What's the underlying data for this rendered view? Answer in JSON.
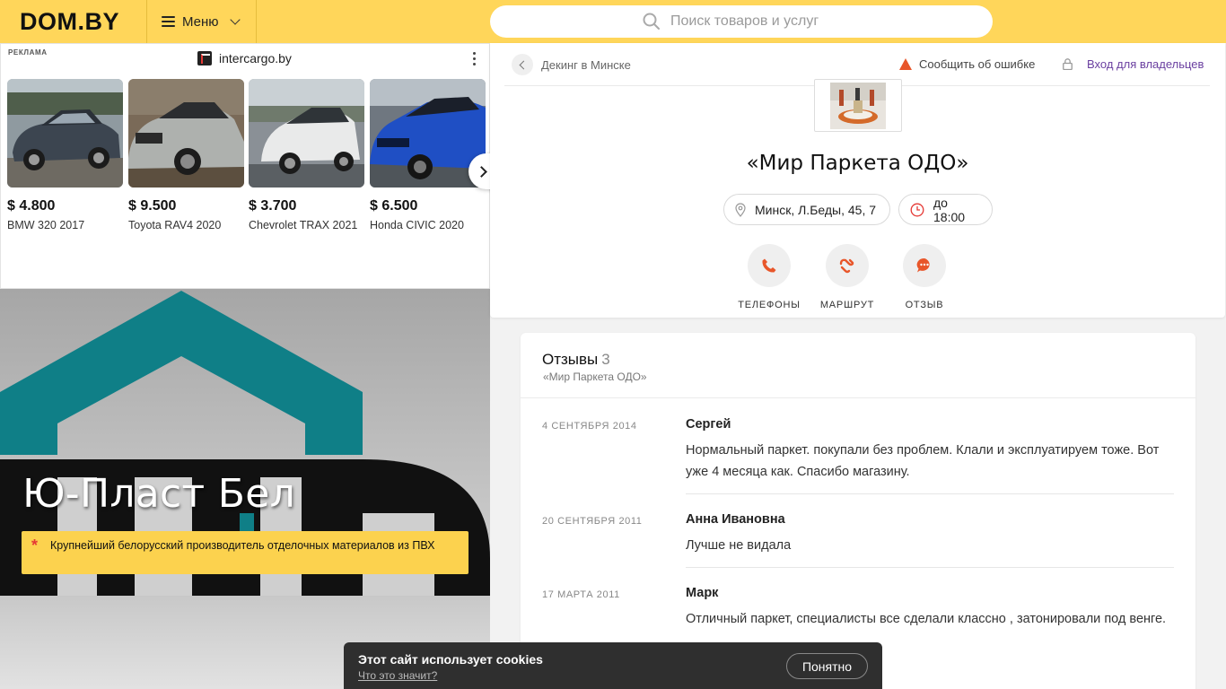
{
  "header": {
    "logo": "DOM.BY",
    "menu_label": "Меню",
    "search_placeholder": "Поиск товаров и услуг"
  },
  "ad": {
    "label": "РЕКЛАМА",
    "source": "intercargo.by",
    "cars": [
      {
        "price": "$ 4.800",
        "name": "BMW 320 2017"
      },
      {
        "price": "$ 9.500",
        "name": "Toyota RAV4 2020"
      },
      {
        "price": "$ 3.700",
        "name": "Chevrolet TRAX 2021"
      },
      {
        "price": "$ 6.500",
        "name": "Honda CIVIC 2020"
      }
    ]
  },
  "banner": {
    "title": "Ю-Пласт Бел",
    "note": "Крупнейший белорусский производитель отделочных материалов из ПВХ"
  },
  "company": {
    "breadcrumb": "Декинг в Минске",
    "report_label": "Сообщить об ошибке",
    "owner_label": "Вход для владельцев",
    "name": "«Мир Паркета ОДО»",
    "address": "Минск, Л.Беды, 45, 7",
    "hours": "до 18:00",
    "actions": {
      "phones": "ТЕЛЕФОНЫ",
      "route": "МАРШРУТ",
      "review": "ОТЗЫВ"
    }
  },
  "reviews": {
    "title": "Отзывы",
    "count": "3",
    "subtitle": "«Мир Паркета ОДО»",
    "items": [
      {
        "date": "4 СЕНТЯБРЯ 2014",
        "author": "Сергей",
        "text": "Нормальный паркет. покупали без проблем. Клали и эксплуатируем тоже. Вот уже 4 месяца как. Спасибо магазину."
      },
      {
        "date": "20 СЕНТЯБРЯ 2011",
        "author": "Анна Ивановна",
        "text": "Лучше не видала"
      },
      {
        "date": "17 МАРТА 2011",
        "author": "Марк",
        "text": "Отличный паркет, специалисты все сделали классно , затонировали под венге."
      }
    ]
  },
  "cookie": {
    "message": "Этот сайт использует cookies",
    "link": "Что это значит?",
    "button": "Понятно"
  },
  "colors": {
    "header": "#ffd65a",
    "accent_orange": "#e8562a",
    "owner_link": "#6a3fa0",
    "banner_teal": "#0f7f87"
  }
}
